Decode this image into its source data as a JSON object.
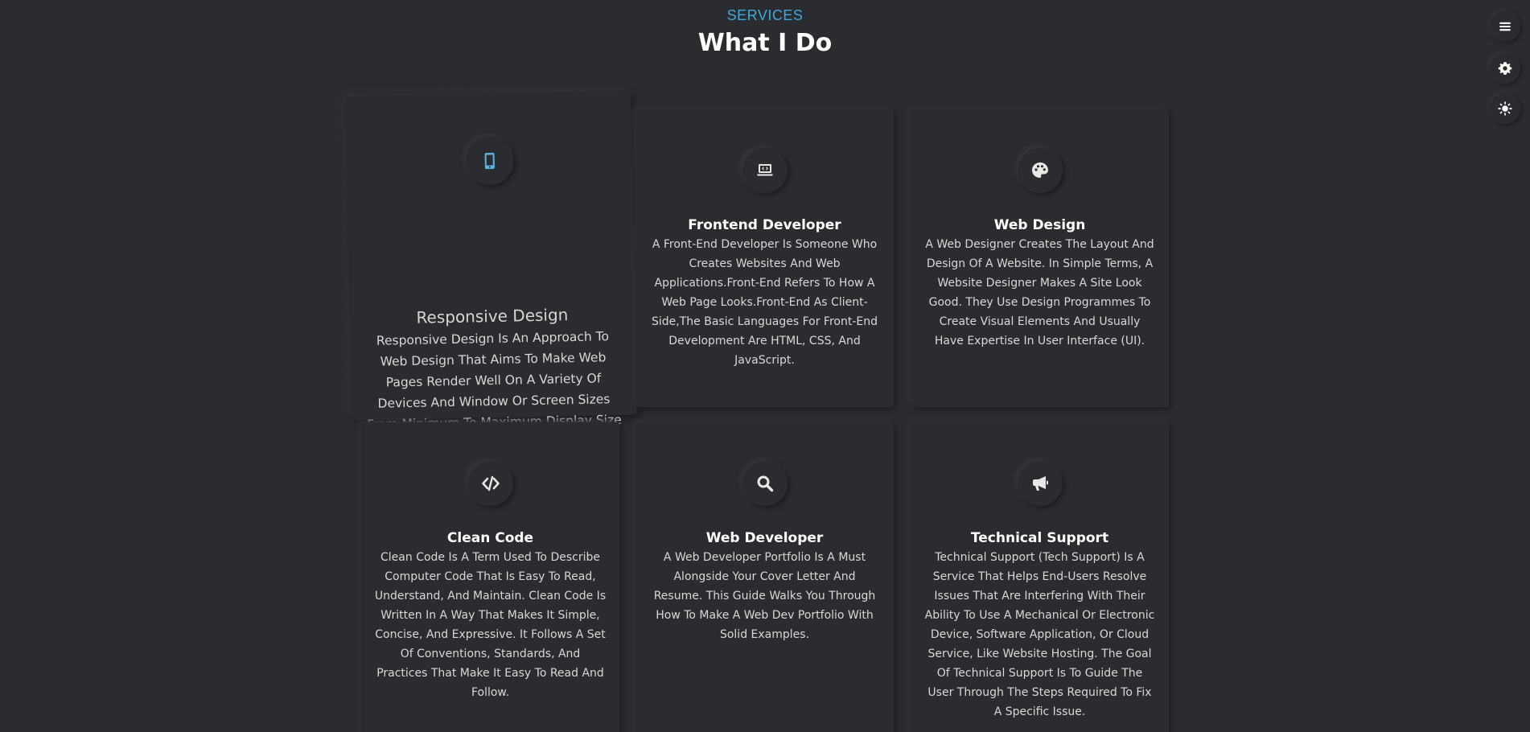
{
  "section": {
    "tag": "SERVICES",
    "title": "What I Do"
  },
  "colors": {
    "accent": "#3fa8de",
    "background": "#2a2c30",
    "icon": "#e8e8e8"
  },
  "side_buttons": [
    {
      "icon": "hamburger-menu-icon"
    },
    {
      "icon": "gear-icon"
    },
    {
      "icon": "sun-icon"
    }
  ],
  "services": [
    {
      "icon": "mobile-phone-icon",
      "title": "Responsive Design",
      "text": "Responsive Design Is An Approach To Web Design That Aims To Make Web Pages Render Well On A Variety Of Devices And Window Or Screen Sizes From Minimum To Maximum Display Size To Ensure Usability And Satisfaction."
    },
    {
      "icon": "laptop-code-icon",
      "title": "Frontend Developer",
      "text": "A Front-End Developer Is Someone Who Creates Websites And Web Applications.Front-End Refers To How A Web Page Looks.Front-End As Client-Side,The Basic Languages For Front-End Development Are HTML, CSS, And JavaScript."
    },
    {
      "icon": "palette-icon",
      "title": "Web Design",
      "text": "A Web Designer Creates The Layout And Design Of A Website. In Simple Terms, A Website Designer Makes A Site Look Good. They Use Design Programmes To Create Visual Elements And Usually Have Expertise In User Interface (UI)."
    },
    {
      "icon": "code-icon",
      "title": "Clean Code",
      "text": "Clean Code Is A Term Used To Describe Computer Code That Is Easy To Read, Understand, And Maintain. Clean Code Is Written In A Way That Makes It Simple, Concise, And Expressive. It Follows A Set Of Conventions, Standards, And Practices That Make It Easy To Read And Follow."
    },
    {
      "icon": "search-icon",
      "title": "Web Developer",
      "text": "A Web Developer Portfolio Is A Must Alongside Your Cover Letter And Resume. This Guide Walks You Through How To Make A Web Dev Portfolio With Solid Examples."
    },
    {
      "icon": "megaphone-icon",
      "title": "Technical Support",
      "text": "Technical Support (Tech Support) Is A Service That Helps End-Users Resolve Issues That Are Interfering With Their Ability To Use A Mechanical Or Electronic Device, Software Application, Or Cloud Service, Like Website Hosting. The Goal Of Technical Support Is To Guide The User Through The Steps Required To Fix A Specific Issue."
    }
  ]
}
